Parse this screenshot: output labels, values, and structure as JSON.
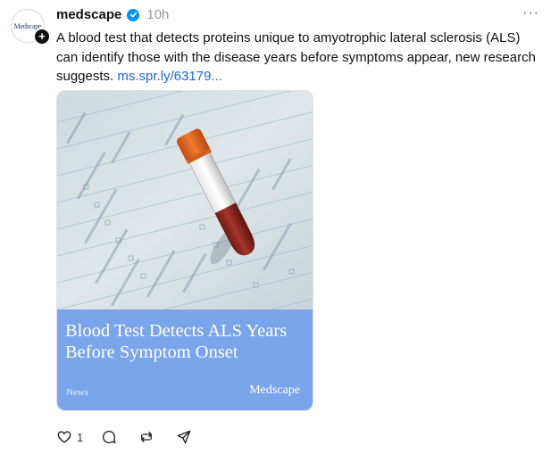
{
  "post": {
    "avatar_text": "Medscape",
    "follow_symbol": "+",
    "username": "medscape",
    "verified": true,
    "time": "10h",
    "more_symbol": "···",
    "text": "A blood test that detects proteins unique to amyotrophic lateral sclerosis (ALS) can identify those with the disease years before symptoms appear, new research suggests.",
    "link": "ms.spr.ly/63179..."
  },
  "card": {
    "title": "Blood Test Detects ALS Years Before Symptom Onset",
    "category": "News",
    "brand": "Medscape",
    "banner_color": "#7ba5ea"
  },
  "actions": {
    "like_count": "1",
    "icons": [
      "heart-icon",
      "comment-icon",
      "repost-icon",
      "share-icon"
    ]
  },
  "colors": {
    "link": "#1f66d8",
    "verified": "#0095f6"
  }
}
